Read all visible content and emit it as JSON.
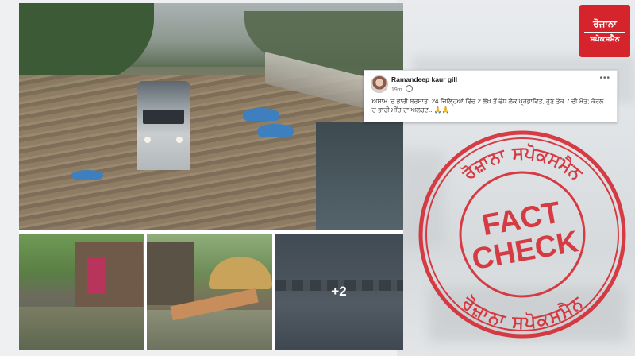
{
  "logo": {
    "line1": "ਰੋਜ਼ਾਨਾ",
    "line2": "ਸਪੋਕਸਮੈਨ",
    "color": "#d6242d"
  },
  "post": {
    "author": "Ramandeep kaur gill",
    "time": "19m",
    "privacy_icon": "globe-icon",
    "more_icon": "more-options-icon",
    "text": "'ਅਸਾਮ 'ਚ ਭਾਰੀ ਬਰਸਾਤ: 24 ਜ਼ਿਲ੍ਹਿਆਂ ਵਿੱਚ 2 ਲੱਖ ਤੋਂ ਵੱਧ ਲੋਕ ਪ੍ਰਭਾਵਿਤ, ਹੁਣ ਤੱਕ 7 ਦੀ ਮੌਤ; ਕੇਰਲ 'ਚ ਭਾਰੀ ਮੀਂਹ ਦਾ ਅਲਰਟ...🙏🙏"
  },
  "collage": {
    "more_count": "+2"
  },
  "stamp": {
    "top_text": "ਰੋਜ਼ਾਨਾ ਸਪੋਕਸਮੈਨ",
    "bottom_text": "ਰੋਜ਼ਾਨਾ ਸਪੋਕਸਮੈਨ",
    "fact": "FACT",
    "check": "CHECK",
    "color": "#d6242d"
  }
}
